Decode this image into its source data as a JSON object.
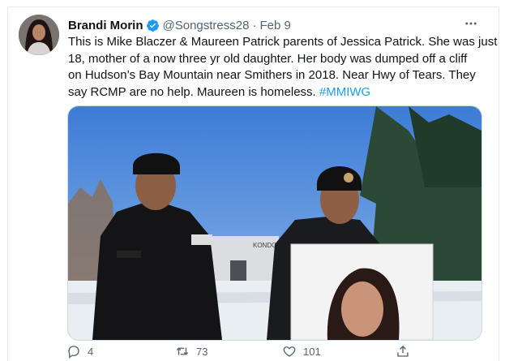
{
  "tweet": {
    "author_name": "Brandi Morin",
    "handle": "@Songstress28",
    "separator": "·",
    "date": "Feb 9",
    "text_lines": [
      "This is Mike Blaczer & Maureen Patrick parents of Jessica Patrick. She was just",
      "18, mother of a now three yr old daughter. Her body was dumped off a cliff",
      "on Hudson’s Bay Mountain near Smithers in 2018. Near Hwy of Tears. They",
      "say RCMP are no help. Maureen is homeless. "
    ],
    "hashtag": "#MMIWG",
    "sign_text": "KONDOLA"
  },
  "actions": {
    "reply_count": "4",
    "retweet_count": "73",
    "like_count": "101"
  },
  "colors": {
    "accent": "#1d9bf0",
    "muted": "#536471",
    "text": "#0f1419"
  },
  "icons": [
    "verified-badge-icon",
    "more-icon",
    "reply-icon",
    "retweet-icon",
    "like-icon",
    "share-icon"
  ]
}
